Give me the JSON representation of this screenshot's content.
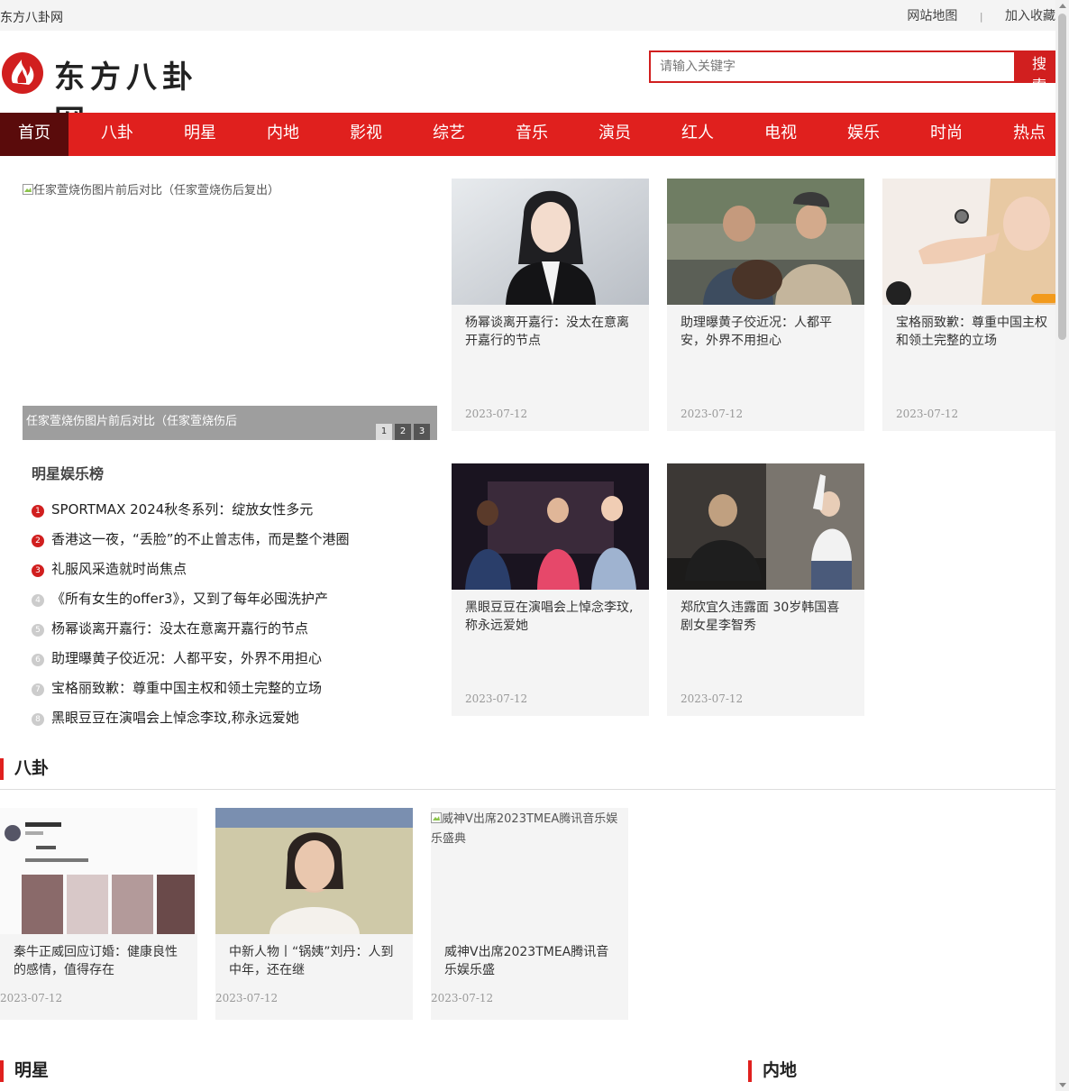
{
  "topbar": {
    "site_name": "东方八卦网",
    "sitemap": "网站地图",
    "separator": "|",
    "bookmark": "加入收藏"
  },
  "logo": {
    "text": "东方八卦网",
    "accent_color": "#d11f1f"
  },
  "search": {
    "placeholder": "请输入关键字",
    "button_label": "搜 索"
  },
  "nav": {
    "items": [
      "首页",
      "八卦",
      "明星",
      "内地",
      "影视",
      "综艺",
      "音乐",
      "演员",
      "红人",
      "电视",
      "娱乐",
      "时尚",
      "热点"
    ],
    "active_index": 0
  },
  "slider": {
    "image_alt": "任家萱烧伤图片前后对比（任家萱烧伤后复出）",
    "caption": "任家萱烧伤图片前后对比（任家萱烧伤后",
    "pages": [
      "1",
      "2",
      "3"
    ],
    "active_page": 0
  },
  "top_cards": [
    {
      "title": "杨幂谈离开嘉行：没太在意离开嘉行的节点",
      "date": "2023-07-12",
      "image": "portrait-woman-black-white"
    },
    {
      "title": "助理曝黄子佼近况：人都平安，外界不用担心",
      "date": "2023-07-12",
      "image": "two-men-with-dog"
    },
    {
      "title": "宝格丽致歉：尊重中国主权和领土完整的立场",
      "date": "2023-07-12",
      "image": "woman-with-watch"
    },
    {
      "title": "黑眼豆豆在演唱会上悼念李玟,称永远爱她",
      "date": "2023-07-12",
      "image": "concert-stage"
    },
    {
      "title": "郑欣宜久违露面 30岁韩国喜剧女星李智秀",
      "date": "2023-07-12",
      "image": "piano-studio"
    }
  ],
  "ranking": {
    "title": "明星娱乐榜",
    "items": [
      "SPORTMAX 2024秋冬系列：绽放女性多元",
      "香港这一夜，“丢脸”的不止曾志伟，而是整个港圈",
      "礼服风采造就时尚焦点",
      "《所有女生的offer3》，又到了每年必囤洗护产",
      "杨幂谈离开嘉行：没太在意离开嘉行的节点",
      "助理曝黄子佼近况：人都平安，外界不用担心",
      "宝格丽致歉：尊重中国主权和领土完整的立场",
      "黑眼豆豆在演唱会上悼念李玟,称永远爱她"
    ],
    "numbers": [
      "1",
      "2",
      "3",
      "4",
      "5",
      "6",
      "7",
      "8"
    ]
  },
  "gossip": {
    "title": "八卦",
    "cards": [
      {
        "title": "秦牛正威回应订婚：健康良性的感情，值得存在",
        "date": "2023-07-12",
        "image": "weibo-post-couple"
      },
      {
        "title": "中新人物丨“锅姨”刘丹：人到中年，还在继",
        "date": "2023-07-12",
        "image": "magazine-cover-woman"
      },
      {
        "title": "威神V出席2023TMEA腾讯音乐娱乐盛",
        "date": "2023-07-12",
        "image_alt": "威神V出席2023TMEA腾讯音乐娱乐盛典"
      }
    ]
  },
  "bottom_sections": {
    "stars": "明星",
    "mainland": "内地"
  }
}
